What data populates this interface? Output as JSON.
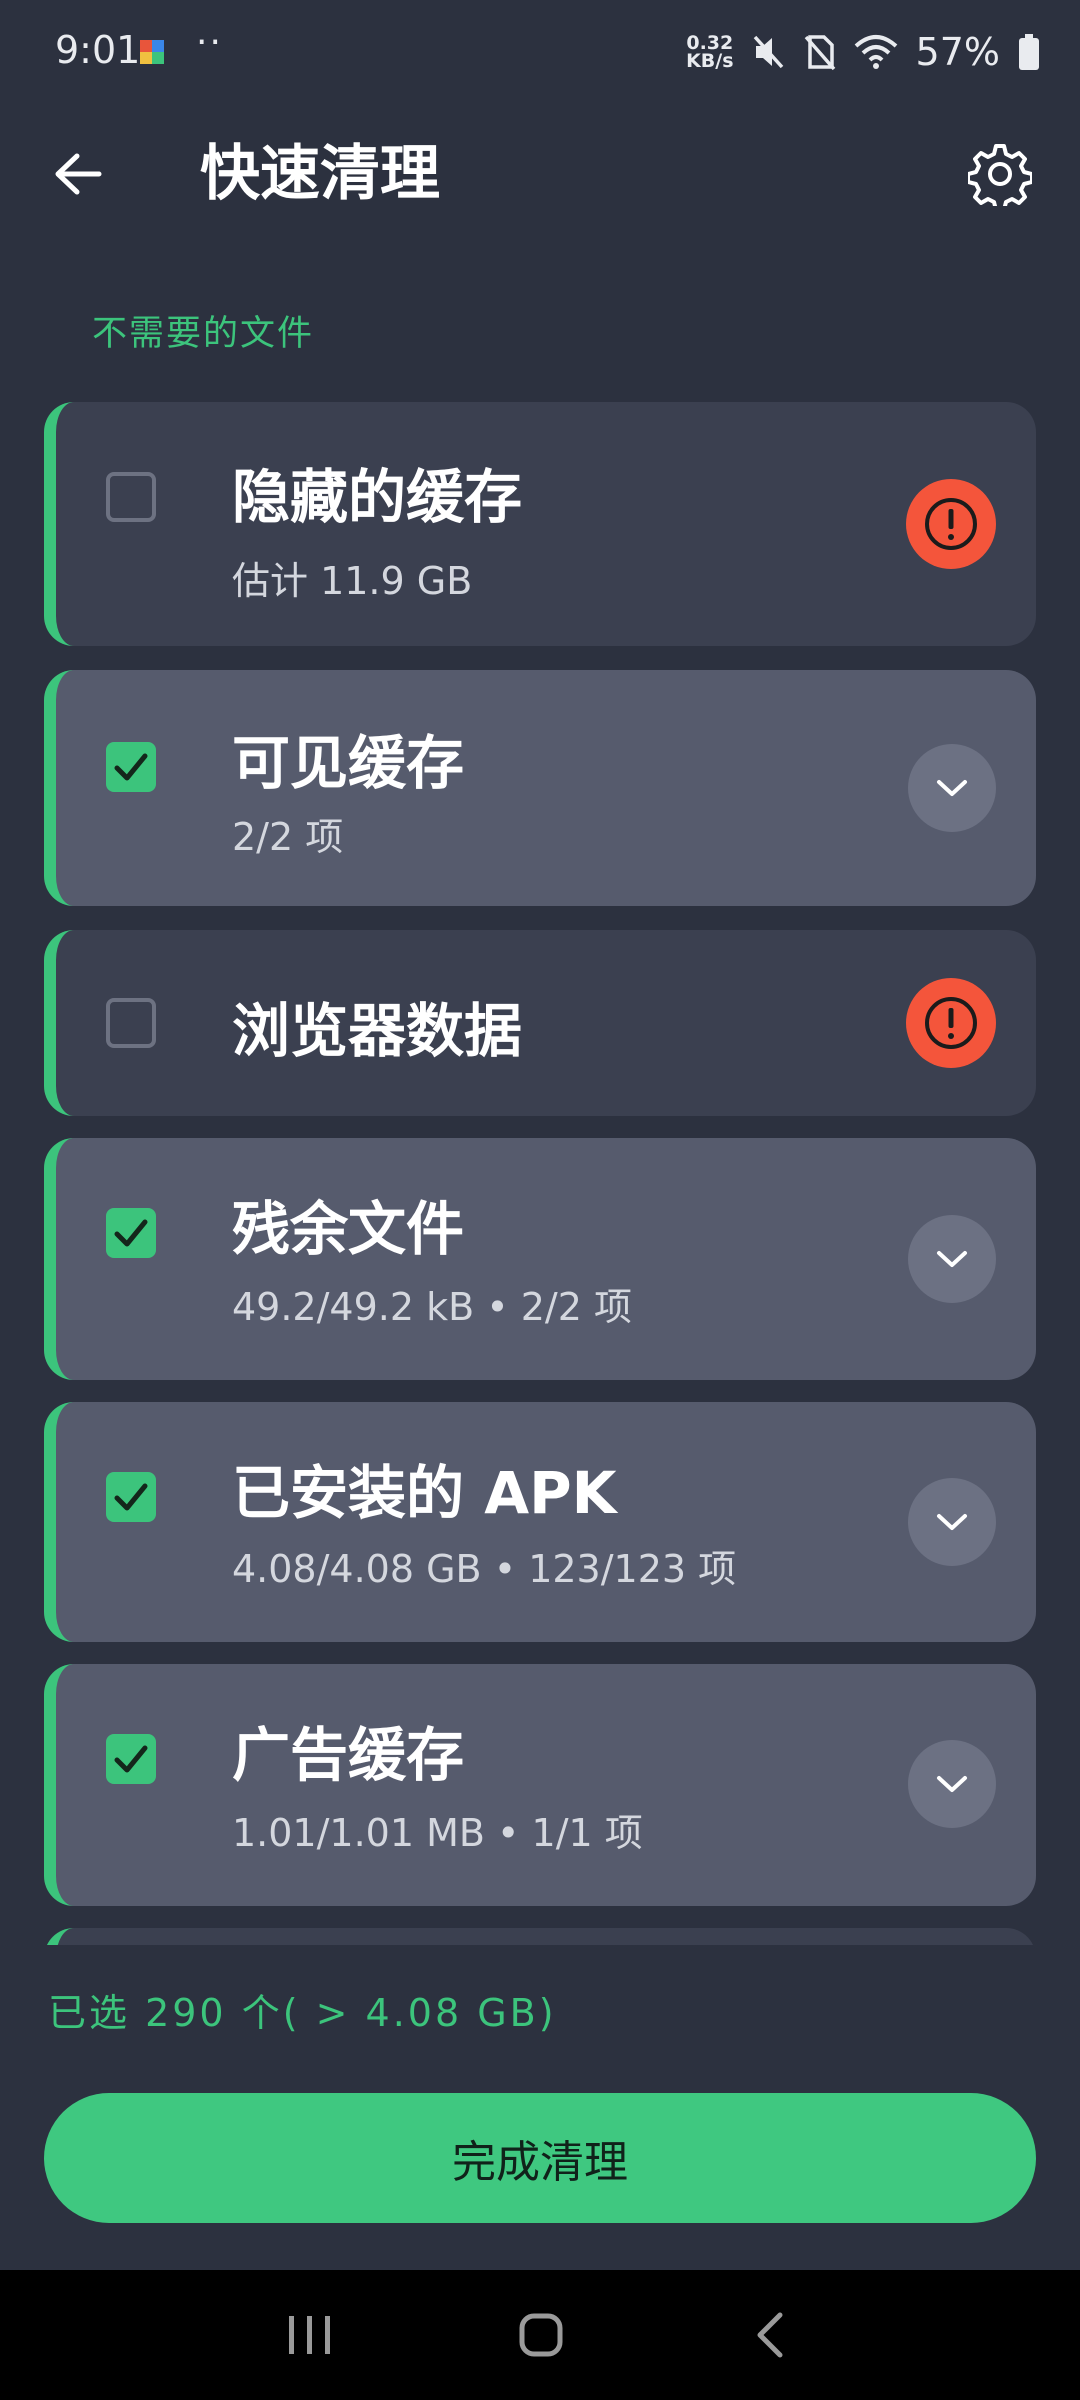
{
  "status_bar": {
    "time": "9:01",
    "dots": "··",
    "net_speed_top": "0.32",
    "net_speed_bottom": "KB/s",
    "battery": "57%"
  },
  "app_bar": {
    "title": "快速清理",
    "back_icon": "arrow-left-icon",
    "settings_icon": "gear-icon"
  },
  "section": {
    "label": "不需要的文件"
  },
  "items": [
    {
      "title": "隐藏的缓存",
      "subtitle": "估计 11.9 GB",
      "checked": false,
      "action": "warning-icon"
    },
    {
      "title": "可见缓存",
      "subtitle": "2/2 项",
      "checked": true,
      "action": "chevron-down-icon"
    },
    {
      "title": "浏览器数据",
      "subtitle": "",
      "checked": false,
      "action": "warning-icon"
    },
    {
      "title": "残余文件",
      "subtitle": "49.2/49.2 kB • 2/2 项",
      "checked": true,
      "action": "chevron-down-icon"
    },
    {
      "title": "已安装的 APK",
      "subtitle": "4.08/4.08 GB • 123/123 项",
      "checked": true,
      "action": "chevron-down-icon"
    },
    {
      "title": "广告缓存",
      "subtitle": "1.01/1.01 MB • 1/1 项",
      "checked": true,
      "action": "chevron-down-icon"
    }
  ],
  "summary": {
    "text": "已选 290 个( > 4.08 GB)"
  },
  "finish_button": {
    "label": "完成清理"
  },
  "colors": {
    "background": "#2c313f",
    "accent": "#3cc47c",
    "warning": "#f4553b"
  }
}
